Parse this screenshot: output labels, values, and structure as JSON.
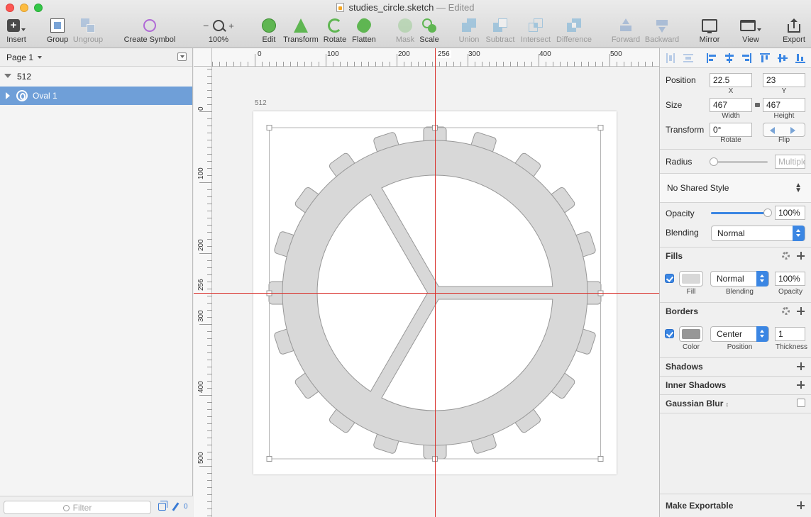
{
  "window": {
    "filename": "studies_circle.sketch",
    "separator": "—",
    "status": "Edited"
  },
  "toolbar": {
    "insert": "Insert",
    "group": "Group",
    "ungroup": "Ungroup",
    "create_symbol": "Create Symbol",
    "zoom_minus": "−",
    "zoom_plus": "+",
    "zoom_level": "100%",
    "edit": "Edit",
    "transform": "Transform",
    "rotate": "Rotate",
    "flatten": "Flatten",
    "mask": "Mask",
    "scale": "Scale",
    "union": "Union",
    "subtract": "Subtract",
    "intersect": "Intersect",
    "difference": "Difference",
    "forward": "Forward",
    "backward": "Backward",
    "mirror": "Mirror",
    "view": "View",
    "export": "Export"
  },
  "layers": {
    "page": "Page 1",
    "artboard": "512",
    "layer": "Oval 1",
    "filter_placeholder": "Filter",
    "brush_count": "0"
  },
  "canvas": {
    "artboard_title": "512",
    "h_ticks": [
      "0",
      "100",
      "200",
      "256",
      "300",
      "400",
      "500"
    ],
    "v_ticks": [
      "0",
      "100",
      "200",
      "256",
      "300",
      "400",
      "500"
    ]
  },
  "inspector": {
    "position_label": "Position",
    "x_value": "22.5",
    "x_label": "X",
    "y_value": "23",
    "y_label": "Y",
    "size_label": "Size",
    "width_value": "467",
    "width_label": "Width",
    "height_value": "467",
    "height_label": "Height",
    "transform_label": "Transform",
    "rotate_value": "0°",
    "rotate_label": "Rotate",
    "flip_label": "Flip",
    "radius_label": "Radius",
    "radius_placeholder": "Multiple",
    "shared_style": "No Shared Style",
    "opacity_label": "Opacity",
    "opacity_value": "100%",
    "opacity_level": 1.0,
    "blending_label": "Blending",
    "blending_value": "Normal",
    "fills_title": "Fills",
    "fill_color": "#d8d8d8",
    "fill_blend": "Normal",
    "fill_opacity": "100%",
    "fill_label": "Fill",
    "fill_blend_label": "Blending",
    "fill_opacity_label": "Opacity",
    "borders_title": "Borders",
    "border_color": "#979797",
    "border_position": "Center",
    "border_thickness": "1",
    "border_color_label": "Color",
    "border_position_label": "Position",
    "border_thickness_label": "Thickness",
    "shadows_title": "Shadows",
    "inner_shadows_title": "Inner Shadows",
    "blur_title": "Gaussian Blur",
    "make_exportable": "Make Exportable"
  }
}
